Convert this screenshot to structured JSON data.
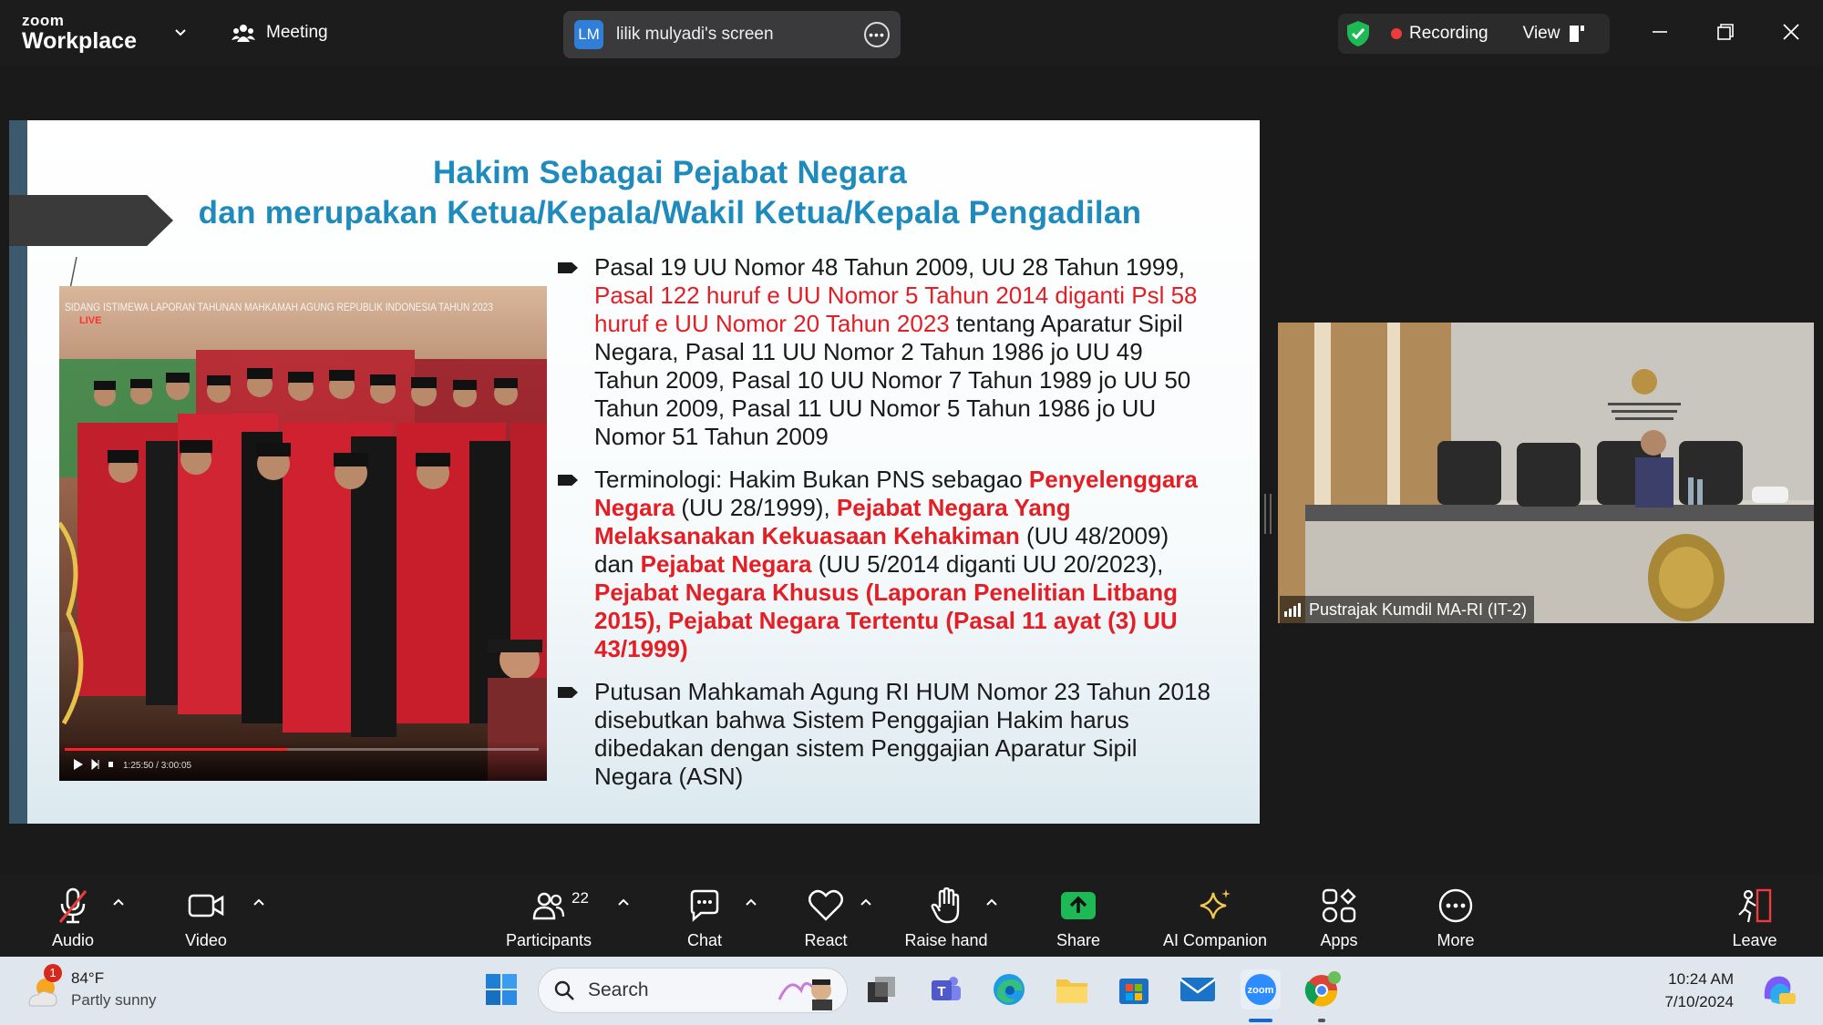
{
  "app": {
    "brand_line1": "zoom",
    "brand_line2": "Workplace",
    "meeting_label": "Meeting"
  },
  "share": {
    "initials": "LM",
    "name": "lilik mulyadi's screen"
  },
  "recording": {
    "label": "Recording",
    "view_label": "View"
  },
  "slide": {
    "title_line1": "Hakim Sebagai Pejabat Negara",
    "title_line2": "dan merupakan Ketua/Kepala/Wakil Ketua/Kepala Pengadilan",
    "video_title": "SIDANG ISTIMEWA LAPORAN TAHUNAN MAHKAMAH AGUNG REPUBLIK INDONESIA TAHUN 2023",
    "video_live": "LIVE",
    "video_time": "1:25:50 / 3:00:05",
    "video_progress": 0.47,
    "b1_a": "Pasal 19 UU Nomor 48 Tahun 2009, UU 28 Tahun 1999,",
    "b1_red": "Pasal 122 huruf e UU Nomor 5 Tahun 2014 diganti  Psl 58 huruf e UU Nomor 20 Tahun 2023",
    "b1_b": " tentang Aparatur Sipil Negara, Pasal 11 UU Nomor 2 Tahun 1986 jo UU 49 Tahun 2009, Pasal 10 UU Nomor 7 Tahun 1989 jo UU 50 Tahun 2009, Pasal 11 UU Nomor 5 Tahun 1986 jo UU Nomor 51 Tahun 2009",
    "b2_a": "Terminologi: Hakim Bukan PNS sebagao ",
    "b2_r1": "Penyelenggara Negara",
    "b2_b": " (UU 28/1999), ",
    "b2_r2": "Pejabat Negara Yang Melaksanakan Kekuasaan Kehakiman",
    "b2_c": " (UU 48/2009) dan ",
    "b2_r3": "Pejabat Negara",
    "b2_d": " (UU 5/2014 diganti UU 20/2023), ",
    "b2_r4": "Pejabat Negara Khusus (Laporan Penelitian Litbang 2015), Pejabat Negara Tertentu (Pasal 11 ayat (3) UU 43/1999)",
    "b3": "Putusan Mahkamah Agung RI HUM Nomor 23 Tahun 2018 disebutkan bahwa Sistem Penggajian Hakim harus dibedakan dengan sistem Penggajian Aparatur Sipil Negara (ASN)"
  },
  "participant_tile": {
    "name": "Pustrajak Kumdil MA-RI (IT-2)"
  },
  "toolbar": {
    "audio": "Audio",
    "video": "Video",
    "participants": "Participants",
    "participants_count": "22",
    "chat": "Chat",
    "react": "React",
    "raise_hand": "Raise hand",
    "share": "Share",
    "ai": "AI Companion",
    "apps": "Apps",
    "more": "More",
    "leave": "Leave"
  },
  "taskbar": {
    "temp": "84°F",
    "weather": "Partly sunny",
    "weather_badge": "1",
    "search_placeholder": "Search",
    "time": "10:24 AM",
    "date": "7/10/2024"
  },
  "colors": {
    "slide_title": "#1f8bbd",
    "emphasis_red": "#e31e24",
    "share_green": "#1db954",
    "recording_red": "#ee3b3b"
  }
}
